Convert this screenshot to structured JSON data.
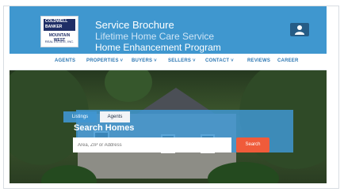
{
  "header": {
    "logo_line1": "COLDWELL BANKER",
    "logo_line2": "MOUNTAIN WEST",
    "logo_line3": "REAL ESTATE, INC.",
    "title_line1": "Service Brochure",
    "title_line2": "Lifetime Home Care Service",
    "title_line3": "Home Enhancement Program",
    "user_icon": "user-icon",
    "colors": {
      "topbar": "#3f97cf",
      "accent": "#f05b3a",
      "nav_text": "#2d77b3"
    }
  },
  "nav": {
    "agents": "AGENTS",
    "properties": "PROPERTIES ˅",
    "buyers": "BUYERS ˅",
    "sellers": "SELLERS ˅",
    "contact": "CONTACT ˅",
    "reviews": "REVIEWS",
    "career": "CAREER"
  },
  "hero": {
    "tabs": {
      "listings": "Listings",
      "agents": "Agents"
    },
    "search_title": "Search Homes",
    "search_placeholder": "Area, ZIP or Address",
    "search_button": "Search"
  }
}
